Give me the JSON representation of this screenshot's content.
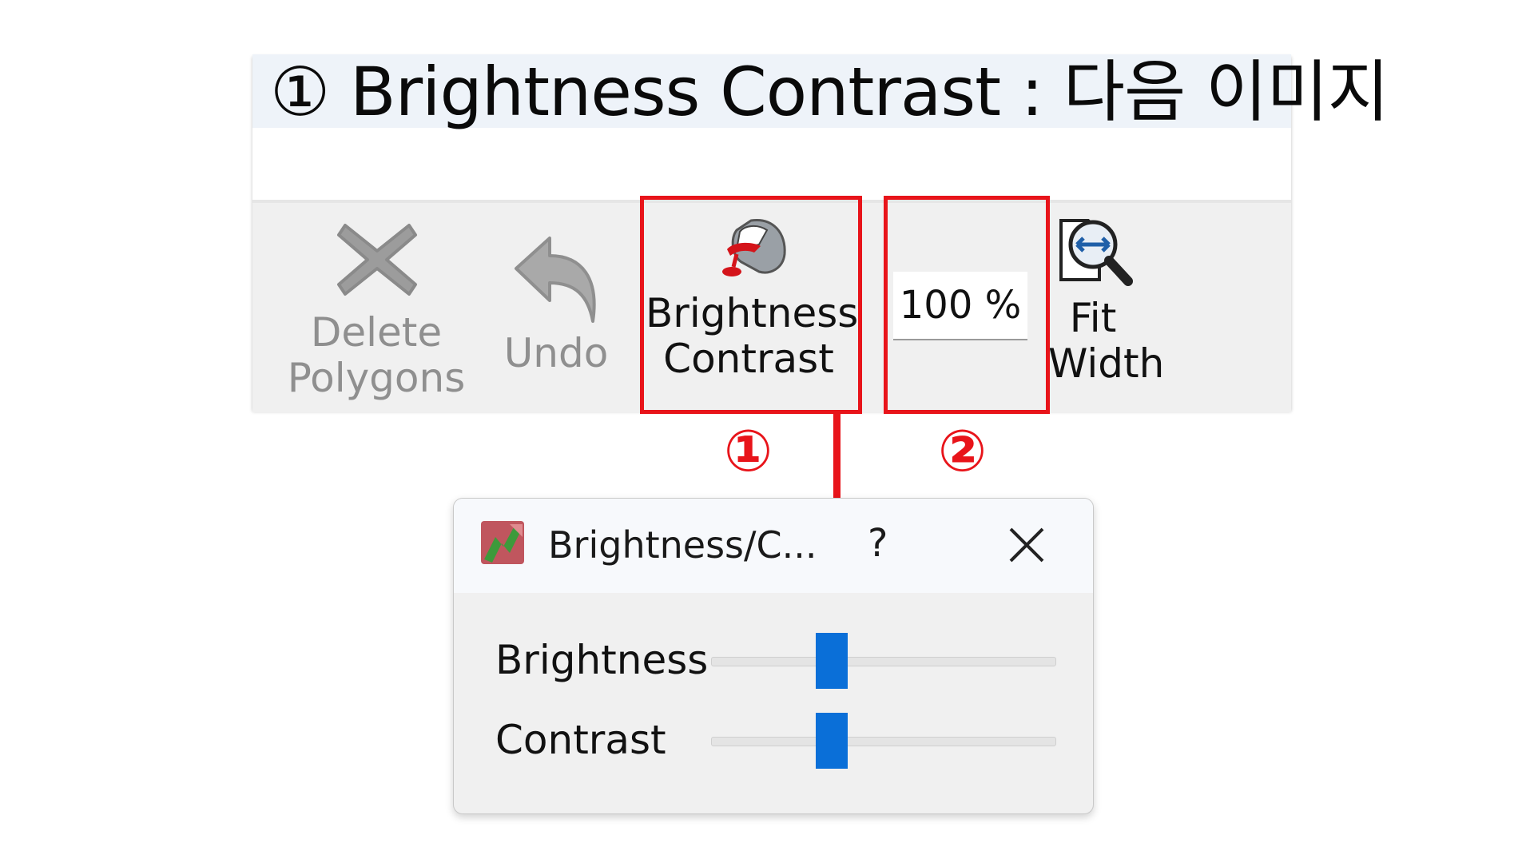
{
  "banner": {
    "title": "① Brightness Contrast : 다음 이미지"
  },
  "toolbar": {
    "delete_polygons": "Delete\nPolygons",
    "undo": "Undo",
    "brightness_contrast": "Brightness\nContrast",
    "zoom_value": "100 %",
    "fit_width": "Fit\nWidth"
  },
  "annotations": {
    "marker_1": "①",
    "marker_2": "②",
    "color": "#e8141a"
  },
  "dialog": {
    "title": "Brightness/C...",
    "help": "?",
    "close_icon": "close-icon",
    "rows": [
      {
        "label": "Brightness",
        "level": 0.35
      },
      {
        "label": "Contrast",
        "level": 0.35
      }
    ],
    "accent": "#0a6fd8"
  }
}
